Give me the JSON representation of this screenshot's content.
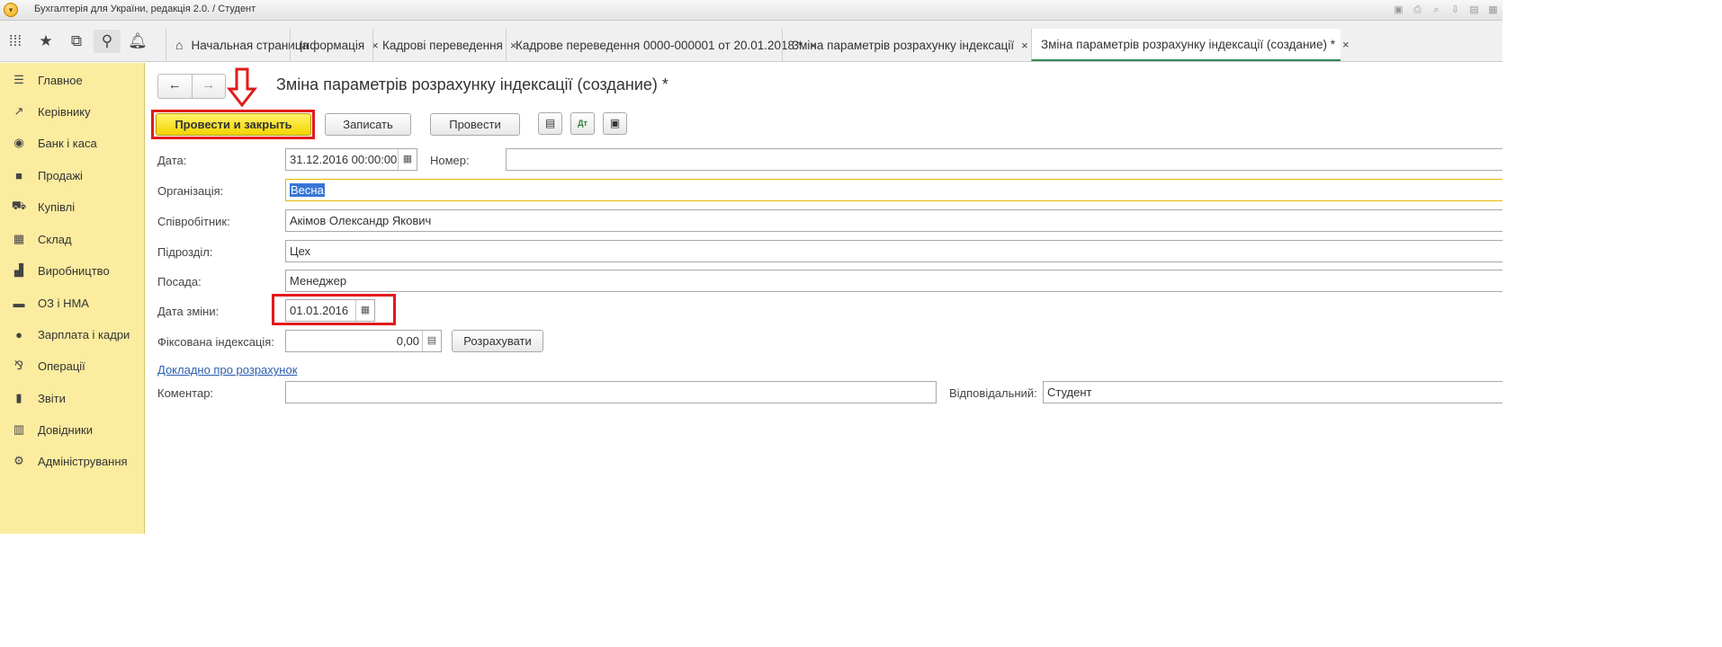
{
  "window": {
    "title": "Бухгалтерія для України, редакція 2.0. / Студент"
  },
  "tabs": [
    {
      "label": "Начальная страница",
      "closable": false
    },
    {
      "label": "Інформація",
      "closable": true
    },
    {
      "label": "Кадрові переведення",
      "closable": true
    },
    {
      "label": "Кадрове переведення 0000-000001 от 20.01.2018 *",
      "closable": true
    },
    {
      "label": "Зміна параметрів розрахунку індексації",
      "closable": true
    },
    {
      "label": "Зміна параметрів розрахунку індексації (создание) *",
      "closable": true,
      "active": true
    }
  ],
  "tab_close_glyph": "×",
  "sidebar": {
    "items": [
      {
        "label": "Главное",
        "icon": "menu-lines-icon"
      },
      {
        "label": "Керівнику",
        "icon": "trend-icon"
      },
      {
        "label": "Банк і каса",
        "icon": "coin-icon"
      },
      {
        "label": "Продажі",
        "icon": "bag-icon"
      },
      {
        "label": "Купівлі",
        "icon": "cart-icon"
      },
      {
        "label": "Склад",
        "icon": "warehouse-icon"
      },
      {
        "label": "Виробництво",
        "icon": "factory-icon"
      },
      {
        "label": "ОЗ і НМА",
        "icon": "truck-icon"
      },
      {
        "label": "Зарплата і кадри",
        "icon": "person-icon"
      },
      {
        "label": "Операції",
        "icon": "dt-kt-icon"
      },
      {
        "label": "Звіти",
        "icon": "bar-chart-icon"
      },
      {
        "label": "Довідники",
        "icon": "books-icon"
      },
      {
        "label": "Адміністрування",
        "icon": "gear-icon"
      }
    ]
  },
  "form": {
    "title": "Зміна параметрів розрахунку індексації (создание) *",
    "buttons": {
      "post_and_close": "Провести и закрыть",
      "save": "Записать",
      "post": "Провести",
      "calculate": "Розрахувати"
    },
    "fields": {
      "date_label": "Дата:",
      "date_value": "31.12.2016 00:00:00",
      "number_label": "Номер:",
      "number_value": "",
      "org_label": "Організація:",
      "org_value": "Весна",
      "employee_label": "Співробітник:",
      "employee_value": "Акімов Олександр Якович",
      "department_label": "Підрозділ:",
      "department_value": "Цех",
      "position_label": "Посада:",
      "position_value": "Менеджер",
      "change_date_label": "Дата зміни:",
      "change_date_value": "01.01.2016",
      "fixed_indexation_label": "Фіксована індексація:",
      "fixed_indexation_value": "0,00",
      "comment_label": "Коментар:",
      "comment_value": "",
      "responsible_label": "Відповідальний:",
      "responsible_value": "Студент"
    },
    "details_link": "Докладно про розрахунок"
  },
  "colors": {
    "sidebar_bg": "#fbeca0",
    "primary_button": "#f3d400",
    "annotation_red": "#e11a1a",
    "active_tab_underline": "#2e8b57",
    "link": "#2a5db0"
  }
}
